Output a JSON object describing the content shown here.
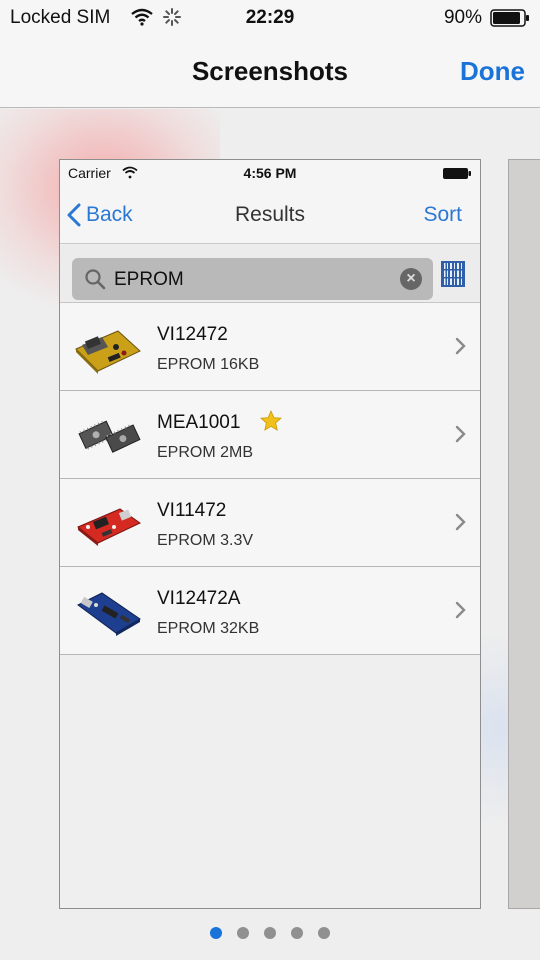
{
  "status_bar": {
    "carrier": "Locked SIM",
    "time": "22:29",
    "battery": "90%"
  },
  "nav": {
    "title": "Screenshots",
    "done_label": "Done"
  },
  "phone": {
    "status_bar": {
      "carrier": "Carrier",
      "time": "4:56 PM"
    },
    "nav": {
      "back_label": "Back",
      "title": "Results",
      "sort_label": "Sort"
    },
    "search": {
      "value": "EPROM",
      "clear_symbol": "×"
    },
    "results": [
      {
        "name": "VI12472",
        "desc": "EPROM 16KB",
        "favorite": false,
        "thumb": "dev-board-yellow"
      },
      {
        "name": "MEA1001",
        "desc": "EPROM 2MB",
        "favorite": true,
        "thumb": "eprom-chips"
      },
      {
        "name": "VI11472",
        "desc": "EPROM 3.3V",
        "favorite": false,
        "thumb": "dev-board-red"
      },
      {
        "name": "VI12472A",
        "desc": "EPROM 32KB",
        "favorite": false,
        "thumb": "dev-board-blue"
      }
    ]
  },
  "page_indicator": {
    "count": 5,
    "active_index": 0
  },
  "colors": {
    "accent": "#1a73d9",
    "link": "#2b78d4",
    "star": "#f1c01a"
  }
}
